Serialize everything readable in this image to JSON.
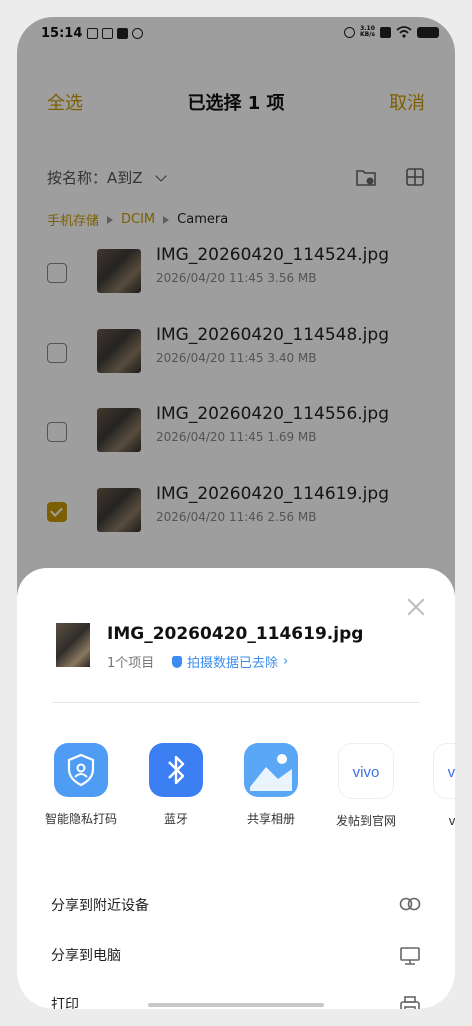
{
  "status_bar": {
    "time": "15:14",
    "net_speed_value": "3.10",
    "net_speed_unit": "KB/s"
  },
  "header": {
    "select_all": "全选",
    "title": "已选择 1 项",
    "cancel": "取消"
  },
  "sort": {
    "label": "按名称：A到Z"
  },
  "breadcrumb": {
    "items": [
      "手机存储",
      "DCIM",
      "Camera"
    ]
  },
  "files": [
    {
      "name": "IMG_20260420_114524.jpg",
      "date": "2026/04/20 11:45",
      "size": "3.56 MB",
      "checked": false
    },
    {
      "name": "IMG_20260420_114548.jpg",
      "date": "2026/04/20 11:45",
      "size": "3.40 MB",
      "checked": false
    },
    {
      "name": "IMG_20260420_114556.jpg",
      "date": "2026/04/20 11:45",
      "size": "1.69 MB",
      "checked": false
    },
    {
      "name": "IMG_20260420_114619.jpg",
      "date": "2026/04/20 11:46",
      "size": "2.56 MB",
      "checked": true
    }
  ],
  "share_sheet": {
    "file_name": "IMG_20260420_114619.jpg",
    "count": "1个项目",
    "privacy_note": "拍摄数据已去除",
    "apps": [
      {
        "label": "智能隐私打码",
        "icon": "privacy-shield-icon",
        "color": "#4f9cf5"
      },
      {
        "label": "蓝牙",
        "icon": "bluetooth-icon",
        "color": "#3b7ff2"
      },
      {
        "label": "共享相册",
        "icon": "shared-album-icon",
        "color": "#5aa7f5"
      },
      {
        "label": "发帖到官网",
        "icon": "vivo-icon",
        "color": "#ffffff"
      },
      {
        "label": "vivo",
        "icon": "vivo-icon",
        "color": "#ffffff"
      }
    ],
    "options": [
      {
        "label": "分享到附近设备",
        "icon": "link-icon"
      },
      {
        "label": "分享到电脑",
        "icon": "monitor-icon"
      },
      {
        "label": "打印",
        "icon": "printer-icon"
      }
    ],
    "vivo_text": "vivo"
  },
  "colors": {
    "accent": "#c99a06",
    "link": "#3c8df0"
  }
}
